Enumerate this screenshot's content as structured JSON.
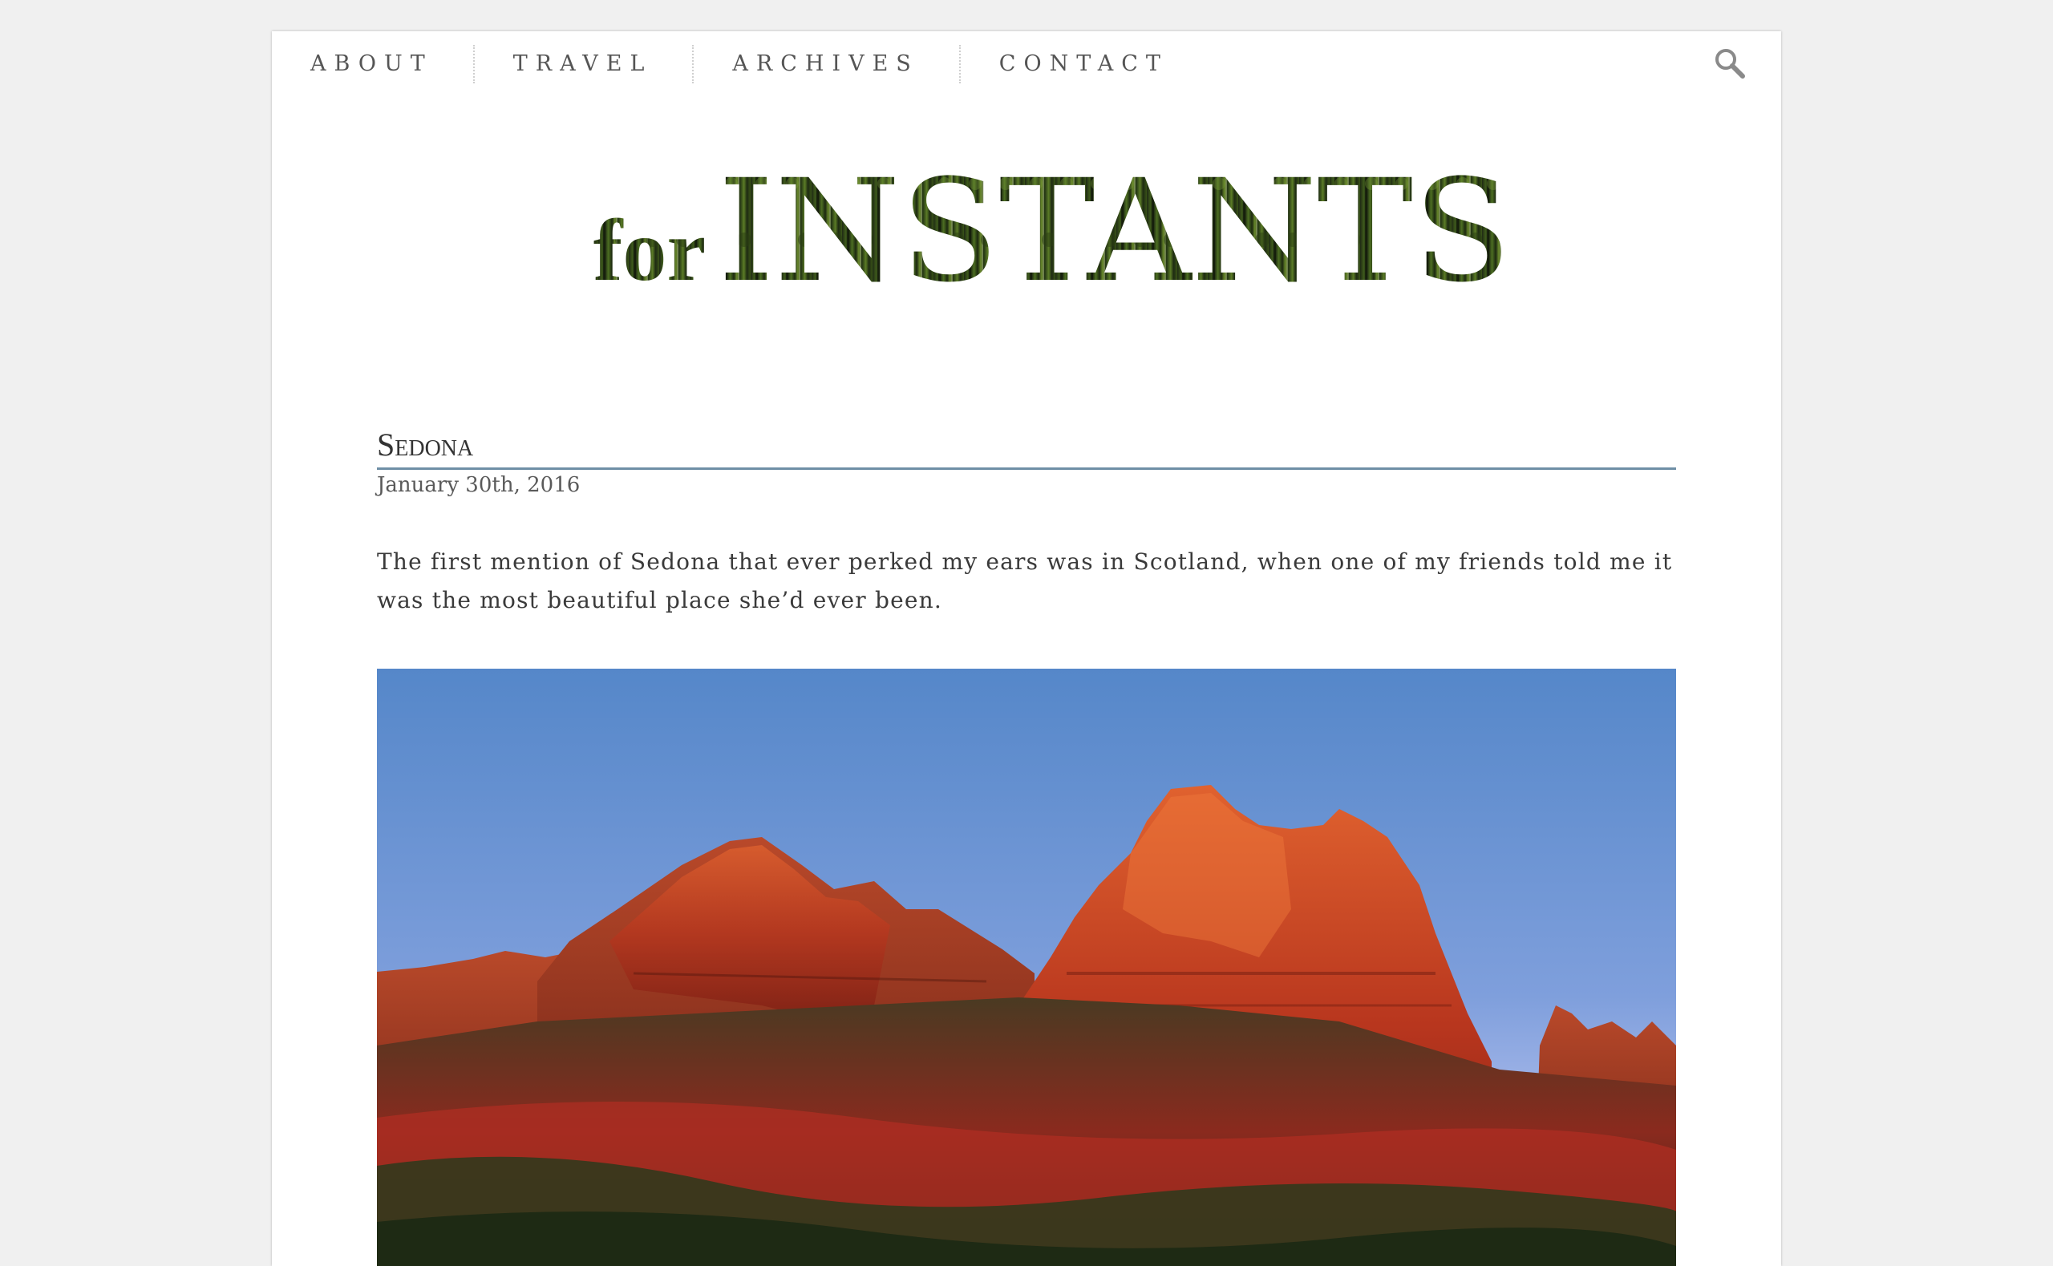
{
  "nav": {
    "items": [
      {
        "label": "ABOUT"
      },
      {
        "label": "TRAVEL"
      },
      {
        "label": "ARCHIVES"
      },
      {
        "label": "CONTACT"
      }
    ],
    "search_icon": "search-icon"
  },
  "logo": {
    "prefix": "for",
    "main": "INSTANTS"
  },
  "post": {
    "title": "Sedona",
    "date": "January 30th, 2016",
    "body": "The first mention of Sedona that ever perked my ears was in Scotland, when one of my friends told me it was the most beautiful place she’d ever been.",
    "image_subject": "Red rock buttes of Sedona at sunset under a blue sky"
  },
  "colors": {
    "background": "#f0f0f0",
    "page": "#ffffff",
    "nav_text": "#555555",
    "title_rule": "#6f8fa6",
    "sky": "#5b8bd0",
    "rock": "#c84a28"
  }
}
